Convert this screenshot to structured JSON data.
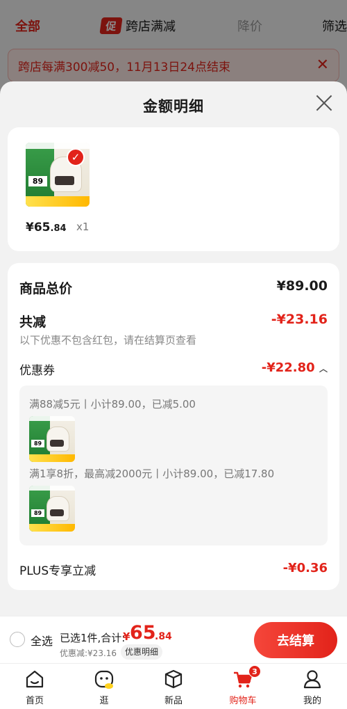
{
  "background": {
    "tabs": {
      "all": "全部",
      "promo_badge": "促",
      "cross_store": "跨店满减",
      "price_drop": "降价",
      "filter": "筛选"
    },
    "banner": {
      "text": "跨店每满300减50，11月13日24点结束",
      "close": "✕"
    }
  },
  "sheet": {
    "title": "金额明细",
    "product": {
      "image_label": "89",
      "selected_mark": "✓",
      "price_int": "¥65",
      "price_dec": ".84",
      "quantity": "x1"
    },
    "summary": {
      "total_label": "商品总价",
      "total_value": "¥89.00",
      "discount_label": "共减",
      "discount_value": "-¥23.16",
      "discount_note": "以下优惠不包含红包，请在结算页查看",
      "coupon_label": "优惠券",
      "coupon_value": "-¥22.80",
      "coupon_chevron": "︿",
      "coupons": [
        {
          "text": "满88减5元丨小计89.00，已减5.00",
          "image_label": "89"
        },
        {
          "text": "满1享8折，最高减2000元丨小计89.00，已减17.80",
          "image_label": "89"
        }
      ],
      "plus_label": "PLUS专享立减",
      "plus_value": "-¥0.36"
    }
  },
  "checkout": {
    "select_all": "全选",
    "selected_text": "已选1件,合计:",
    "total_symbol": "¥",
    "total_int": "65",
    "total_dec": ".84",
    "saved_text": "优惠减:¥23.16",
    "detail_button": "优惠明细",
    "checkout_button": "去结算"
  },
  "tabbar": {
    "items": [
      {
        "label": "首页",
        "icon": "home-icon"
      },
      {
        "label": "逛",
        "icon": "explore-icon"
      },
      {
        "label": "新品",
        "icon": "box-icon"
      },
      {
        "label": "购物车",
        "icon": "cart-icon",
        "active": true,
        "badge": "3"
      },
      {
        "label": "我的",
        "icon": "profile-icon"
      }
    ]
  },
  "colors": {
    "accent": "#e2231a",
    "sheet_bg": "#f2f2f2",
    "card_bg": "#ffffff"
  }
}
